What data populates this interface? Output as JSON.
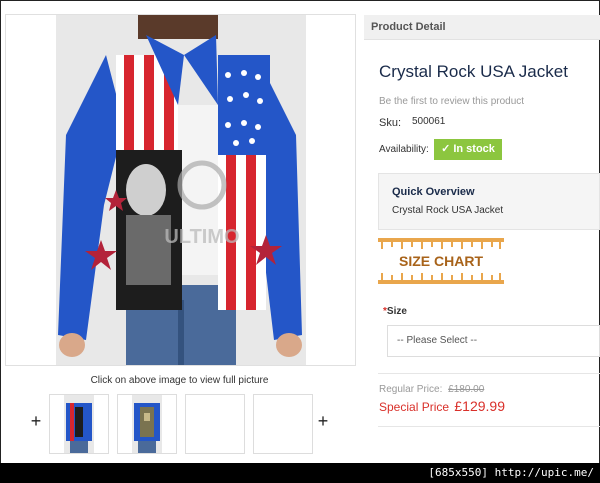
{
  "gallery": {
    "click_hint": "Click on above image to view full picture",
    "prev_label": "+",
    "next_label": "+"
  },
  "product": {
    "section_title": "Product Detail",
    "name": "Crystal Rock USA Jacket",
    "review_link": "Be the first to review this product",
    "sku_label": "Sku:",
    "sku_value": "500061",
    "availability_label": "Availability:",
    "stock_status": "In stock",
    "check_icon": "✓",
    "overview_title": "Quick Overview",
    "overview_text": "Crystal Rock USA Jacket",
    "size_chart_label": "SIZE CHART",
    "size_label": "Size",
    "size_required_mark": "*",
    "size_placeholder": "-- Please Select --",
    "regular_price_label": "Regular Price:",
    "regular_price": "£180.00",
    "special_price_label": "Special Price",
    "special_price": "£129.99"
  },
  "watermark": {
    "brand": "ULTIMO"
  },
  "footer": {
    "caption": "[685x550] http://upic.me/"
  },
  "colors": {
    "accent_green": "#8cc63f",
    "special_red": "#d9302a",
    "title_navy": "#1a2b4a"
  }
}
